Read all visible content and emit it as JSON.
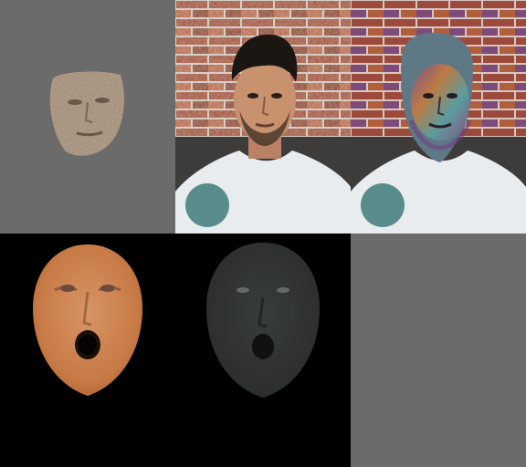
{
  "grid": {
    "rows": 2,
    "cols": 3,
    "panels": [
      {
        "id": "texture-face",
        "background": "#6b6b6b"
      },
      {
        "id": "original-photo",
        "background": "#8a5a45"
      },
      {
        "id": "overlay-photo",
        "background": "#8a5a45"
      },
      {
        "id": "rendered-face-skin",
        "background": "#000000"
      },
      {
        "id": "rendered-face-dark",
        "background": "#000000"
      },
      {
        "id": "empty-gray",
        "background": "#6b6b6b"
      }
    ]
  },
  "colors": {
    "gray": "#6b6b6b",
    "brick": "#9b5a45",
    "mortar": "#c9c2b8",
    "shirt": "#e9ecef",
    "skin": "#c8926e",
    "hair": "#1b1612",
    "overlay": "#5f7886",
    "render_skin": "#d1844f",
    "render_dark": "#2e3130",
    "teal": "#3f7d7a"
  }
}
